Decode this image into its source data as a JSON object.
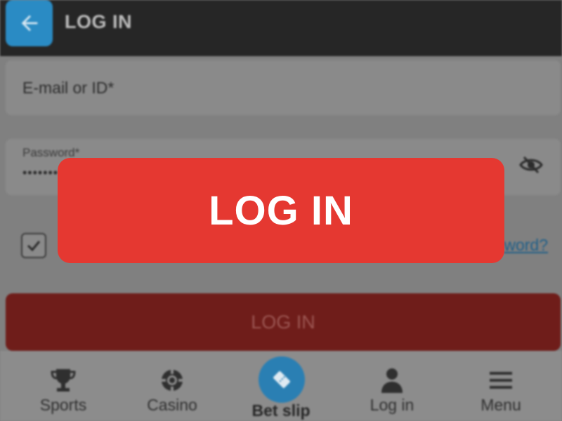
{
  "header": {
    "title": "LOG IN",
    "back_icon": "arrow-left-icon"
  },
  "form": {
    "email_label": "E-mail or ID*",
    "password_label": "Password*",
    "password_value": "••••••••",
    "eye_icon": "eye-slash-icon",
    "remember_checked": true,
    "forgot_link_visible": "word?",
    "login_button_label": "LOG IN"
  },
  "overlay": {
    "button_label": "LOG IN"
  },
  "bottom_nav": {
    "items": [
      {
        "label": "Sports",
        "icon": "trophy-icon"
      },
      {
        "label": "Casino",
        "icon": "chip-icon"
      },
      {
        "label": "Bet slip",
        "icon": "ticket-icon",
        "active": true
      },
      {
        "label": "Log in",
        "icon": "user-icon"
      },
      {
        "label": "Menu",
        "icon": "hamburger-icon"
      }
    ]
  },
  "colors": {
    "accent_red": "#e53831",
    "accent_blue": "#2a8bc4",
    "topbar": "#262626"
  }
}
